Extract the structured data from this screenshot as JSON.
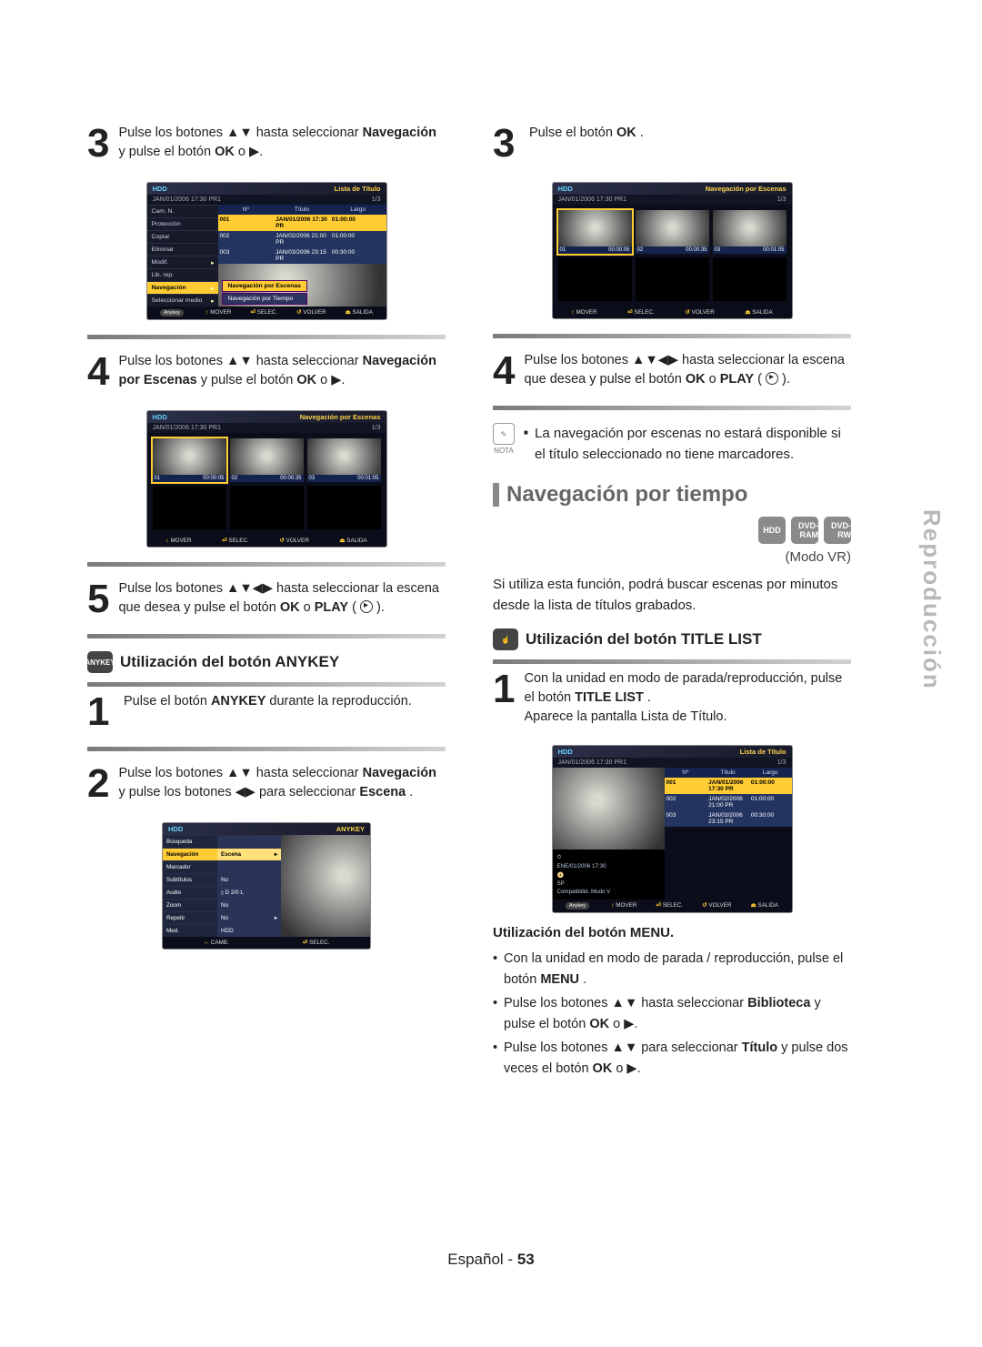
{
  "side_tab": "Reproducción",
  "footer": {
    "lang": "Español",
    "page": "53"
  },
  "left": {
    "step3": {
      "num": "3",
      "text_before": "Pulse los botones ▲▼ hasta seleccionar ",
      "b1": "Navegación",
      "text_mid": " y pulse el botón ",
      "b2": "OK",
      "text_after": " o ▶."
    },
    "step4": {
      "num": "4",
      "text_before": "Pulse los botones ▲▼ hasta seleccionar ",
      "b1": "Navegación por Escenas",
      "text_mid": " y pulse el botón ",
      "b2": "OK",
      "text_after": " o ▶."
    },
    "step5": {
      "num": "5",
      "text_before": "Pulse los botones ▲▼◀▶ hasta seleccionar la escena que desea y pulse el botón ",
      "b1": "OK",
      "text_mid": " o ",
      "b2": "PLAY",
      "text_after": " ("
    },
    "anykey_heading": "Utilización del botón ANYKEY",
    "a_step1": {
      "num": "1",
      "text_before": "Pulse el botón ",
      "b1": "ANYKEY",
      "text_after": " durante la reproducción."
    },
    "a_step2": {
      "num": "2",
      "text_before": "Pulse los botones ▲▼ hasta seleccionar ",
      "b1": "Navegación",
      "text_mid": " y pulse los botones ◀▶ para seleccionar ",
      "b2": "Escena",
      "text_after": "."
    }
  },
  "right": {
    "step3": {
      "num": "3",
      "text_before": "Pulse el botón ",
      "b1": "OK",
      "text_after": "."
    },
    "step4": {
      "num": "4",
      "text_before": "Pulse los botones ▲▼◀▶ hasta seleccionar la escena que desea y pulse el botón ",
      "b1": "OK",
      "text_mid": " o ",
      "b2": "PLAY",
      "text_after": "("
    },
    "note_label": "NOTA",
    "note_msg": "La navegación por escenas no estará disponible si el título seleccionado no tiene marcadores.",
    "nav_tiempo": "Navegación por tiempo",
    "media": [
      "HDD",
      "DVD-RAM",
      "DVD-RW"
    ],
    "mode": "(Modo VR)",
    "intro": "Si utiliza esta función, podrá buscar escenas por minutos desde la lista de títulos grabados.",
    "title_list_heading": "Utilización del botón TITLE LIST",
    "t_step1": {
      "num": "1",
      "line1_before": "Con la unidad en modo de parada/reproducción, pulse el botón ",
      "b1": "TITLE LIST",
      "line1_after": ".",
      "line2": "Aparece la pantalla Lista de Título."
    },
    "menu_heading": "Utilización del botón MENU.",
    "menu_bul": [
      {
        "pre": "Con la unidad en modo de parada / reproducción, pulse el botón ",
        "b": "MENU",
        "post": "."
      },
      {
        "pre": "Pulse los botones ▲▼ hasta seleccionar ",
        "b": "Biblioteca",
        "post": " y pulse el botón ",
        "b2": "OK",
        "post2": " o ▶."
      },
      {
        "pre": "Pulse los botones ▲▼ para seleccionar ",
        "b": "Título",
        "post": " y pulse dos veces el botón ",
        "b2": "OK",
        "post2": " o ▶."
      }
    ]
  },
  "osd": {
    "hdd": "HDD",
    "title_list": "Lista de Título",
    "scene_nav": "Navegación por Escenas",
    "anykey_badge": "Anykey",
    "sub_date": "JAN/01/2006 17:30 PR1",
    "sub_count": "1/3",
    "menu": [
      "Cam. N.",
      "Protección",
      "Copiar",
      "Eliminar",
      "Modif.",
      "Lib. rep.",
      "Navegación",
      "Seleccionar medio"
    ],
    "submenu": [
      "Navegación por Escenas",
      "Navegación por Tiempo"
    ],
    "foot": {
      "mover": "MOVER",
      "selec": "SELEC.",
      "volver": "VOLVER",
      "salida": "SALIDA",
      "camb": "CAMB."
    },
    "tbl_hdr": [
      "Nº",
      "Título",
      "Largo"
    ],
    "tbl_rows": [
      [
        "001",
        "JAN/01/2006 17:30 PR",
        "01:00:00"
      ],
      [
        "002",
        "JAN/02/2006 21:00 PR",
        "01:00:00"
      ],
      [
        "003",
        "JAN/03/2006 23:15 PR",
        "00:30:00"
      ]
    ],
    "meta": [
      "ENE/01/2006 17:30",
      "SP",
      "Compatibilid. Modo V"
    ],
    "scene_cells": [
      {
        "n": "01",
        "t": "00:00:05"
      },
      {
        "n": "02",
        "t": "00:00:35"
      },
      {
        "n": "03",
        "t": "00:01:05"
      }
    ],
    "anyk_rows": [
      [
        "Búsqueda",
        ""
      ],
      [
        "Navegación",
        "Escena"
      ],
      [
        "Marcador",
        ""
      ],
      [
        "Subtítulos",
        "No"
      ],
      [
        "Audio",
        "D 2/0 L"
      ],
      [
        "Zoom",
        "No"
      ],
      [
        "Repetir",
        "No"
      ],
      [
        "Med.",
        "HDD"
      ]
    ],
    "anyk_title": "ANYKEY"
  }
}
